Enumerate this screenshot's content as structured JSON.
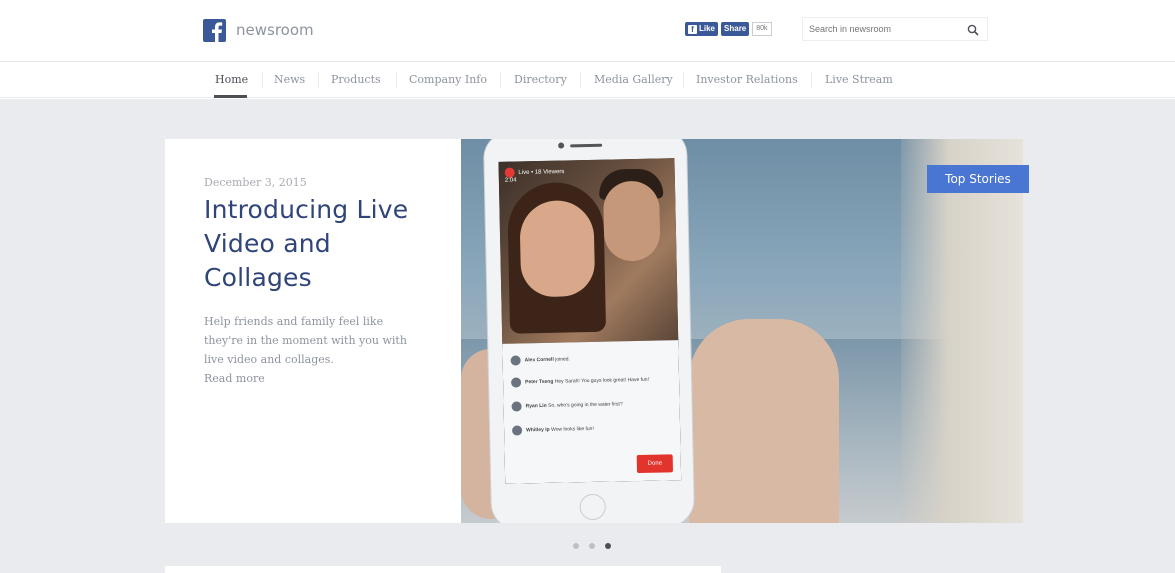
{
  "header": {
    "brand": "newsroom",
    "like_label": "Like",
    "share_label": "Share",
    "share_count": "80k",
    "search_placeholder": "Search in newsroom"
  },
  "nav": {
    "items": [
      {
        "label": "Home",
        "active": true
      },
      {
        "label": "News",
        "active": false
      },
      {
        "label": "Products",
        "active": false
      },
      {
        "label": "Company Info",
        "active": false
      },
      {
        "label": "Directory",
        "active": false
      },
      {
        "label": "Media Gallery",
        "active": false
      },
      {
        "label": "Investor Relations",
        "active": false
      },
      {
        "label": "Live Stream",
        "active": false
      }
    ]
  },
  "hero": {
    "date": "December 3, 2015",
    "title": "Introducing Live Video and Collages",
    "description": "Help friends and family feel like they're in the moment with you with live video and collages.",
    "read_more": "Read more",
    "badge": "Top Stories",
    "phone": {
      "live_label": "Live • 18 Viewers",
      "live_time": "2:04",
      "comments": [
        {
          "name": "Alex Cornell",
          "text": "joined."
        },
        {
          "name": "Peter Tseng",
          "text": "Hey Sarah! You guys look great! Have fun!"
        },
        {
          "name": "Ryan Lin",
          "text": "So, who's going in the water first?"
        },
        {
          "name": "Whitley Ip",
          "text": "Wow looks like fun!"
        }
      ],
      "done_label": "Done"
    }
  },
  "carousel": {
    "slides": 3,
    "active_index": 2
  },
  "colors": {
    "brand_blue": "#3b5998",
    "title_blue": "#2f4479",
    "badge_blue": "#4a76d3",
    "stage_gray": "#e9ebee"
  }
}
